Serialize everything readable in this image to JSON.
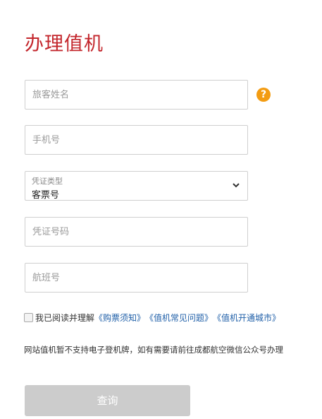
{
  "page": {
    "title": "办理值机"
  },
  "form": {
    "name_placeholder": "旅客姓名",
    "phone_placeholder": "手机号",
    "id_type_label": "凭证类型",
    "id_type_value": "客票号",
    "id_number_placeholder": "凭证号码",
    "flight_placeholder": "航班号",
    "help_glyph": "?",
    "help_color": "#f39c12"
  },
  "agreement": {
    "prefix": "我已阅读并理解",
    "links": [
      "《购票须知》",
      "《值机常见问题》",
      "《值机开通城市》"
    ],
    "checked": false,
    "link_color": "#1f5fa8"
  },
  "notice": "网站值机暂不支持电子登机牌，如有需要请前往成都航空微信公众号办理",
  "actions": {
    "query_label": "查询",
    "query_enabled": false
  },
  "colors": {
    "title": "#c3262c",
    "button_disabled": "#cccccc"
  }
}
